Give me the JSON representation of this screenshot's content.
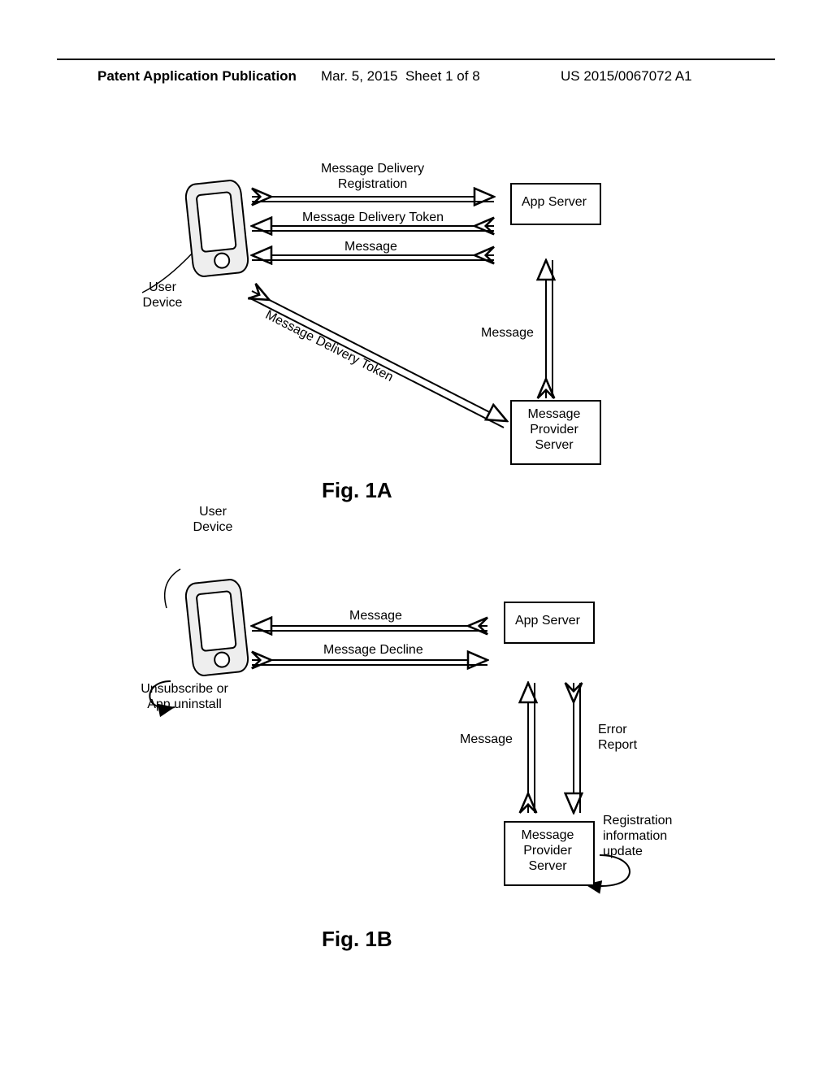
{
  "header": {
    "left": "Patent Application Publication",
    "date": "Mar. 5, 2015",
    "sheet": "Sheet 1 of 8",
    "pubno": "US 2015/0067072 A1"
  },
  "figA": {
    "caption": "Fig. 1A",
    "userDevice": "User\nDevice",
    "appServer": "App Server",
    "msgProvider": "Message\nProvider\nServer",
    "arrows": {
      "title": "Message Delivery\nRegistration",
      "token": "Message Delivery Token",
      "message": "Message",
      "diag": "Message Delivery Token",
      "up": "Message"
    }
  },
  "figB": {
    "caption": "Fig. 1B",
    "userDevice": "User\nDevice",
    "unsub": "Unsubscribe or\nApp uninstall",
    "appServer": "App Server",
    "msgProvider": "Message\nProvider\nServer",
    "regUpdate": "Registration\ninformation\nupdate",
    "arrows": {
      "message": "Message",
      "decline": "Message Decline",
      "up": "Message",
      "down": "Error\nReport"
    }
  }
}
